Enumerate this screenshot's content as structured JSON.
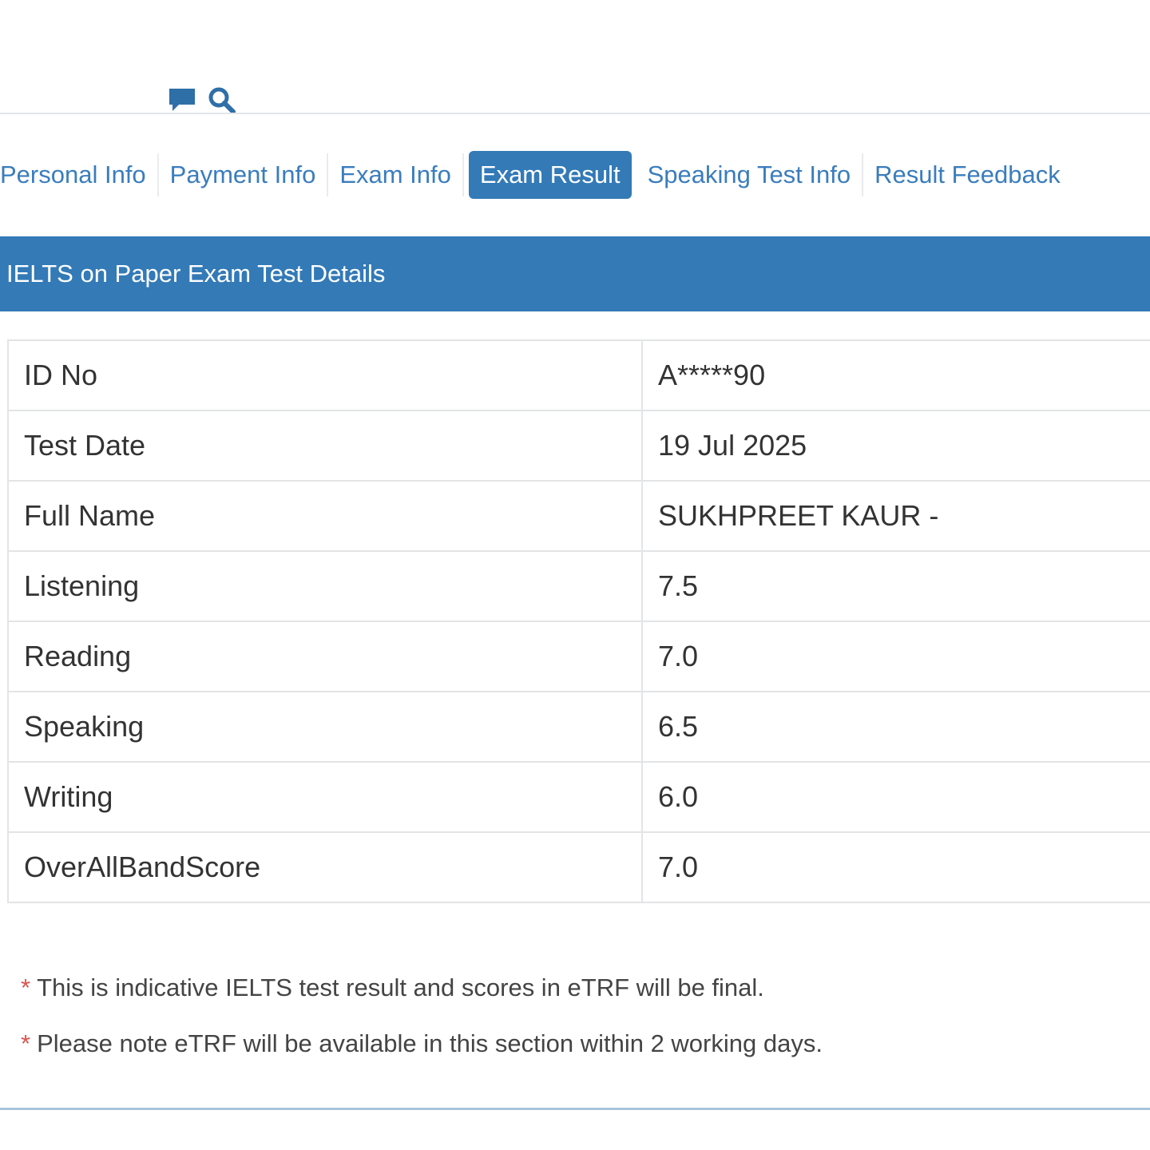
{
  "tabs": [
    {
      "label": "Personal Info"
    },
    {
      "label": "Payment Info"
    },
    {
      "label": "Exam Info"
    },
    {
      "label": "Exam Result"
    },
    {
      "label": "Speaking Test Info"
    },
    {
      "label": "Result Feedback"
    }
  ],
  "active_tab": "Exam Result",
  "section": {
    "title": "IELTS on Paper Exam Test Details"
  },
  "results": [
    {
      "label": "ID No",
      "value": "A*****90"
    },
    {
      "label": "Test Date",
      "value": "19 Jul 2025"
    },
    {
      "label": "Full Name",
      "value": "SUKHPREET KAUR -"
    },
    {
      "label": "Listening",
      "value": "7.5"
    },
    {
      "label": "Reading",
      "value": "7.0"
    },
    {
      "label": "Speaking",
      "value": "6.5"
    },
    {
      "label": "Writing",
      "value": "6.0"
    },
    {
      "label": "OverAllBandScore",
      "value": "7.0"
    }
  ],
  "notes": [
    {
      "marker": "*",
      "text": "This is indicative IELTS test result and scores in eTRF will be final."
    },
    {
      "marker": "*",
      "text": "Please note eTRF will be available in this section within 2 working days."
    }
  ],
  "icons": {
    "chat": "chat-icon",
    "search": "search-icon"
  },
  "colors": {
    "primary": "#337ab7",
    "link": "#3a7dbd",
    "asterisk": "#d9534f"
  }
}
